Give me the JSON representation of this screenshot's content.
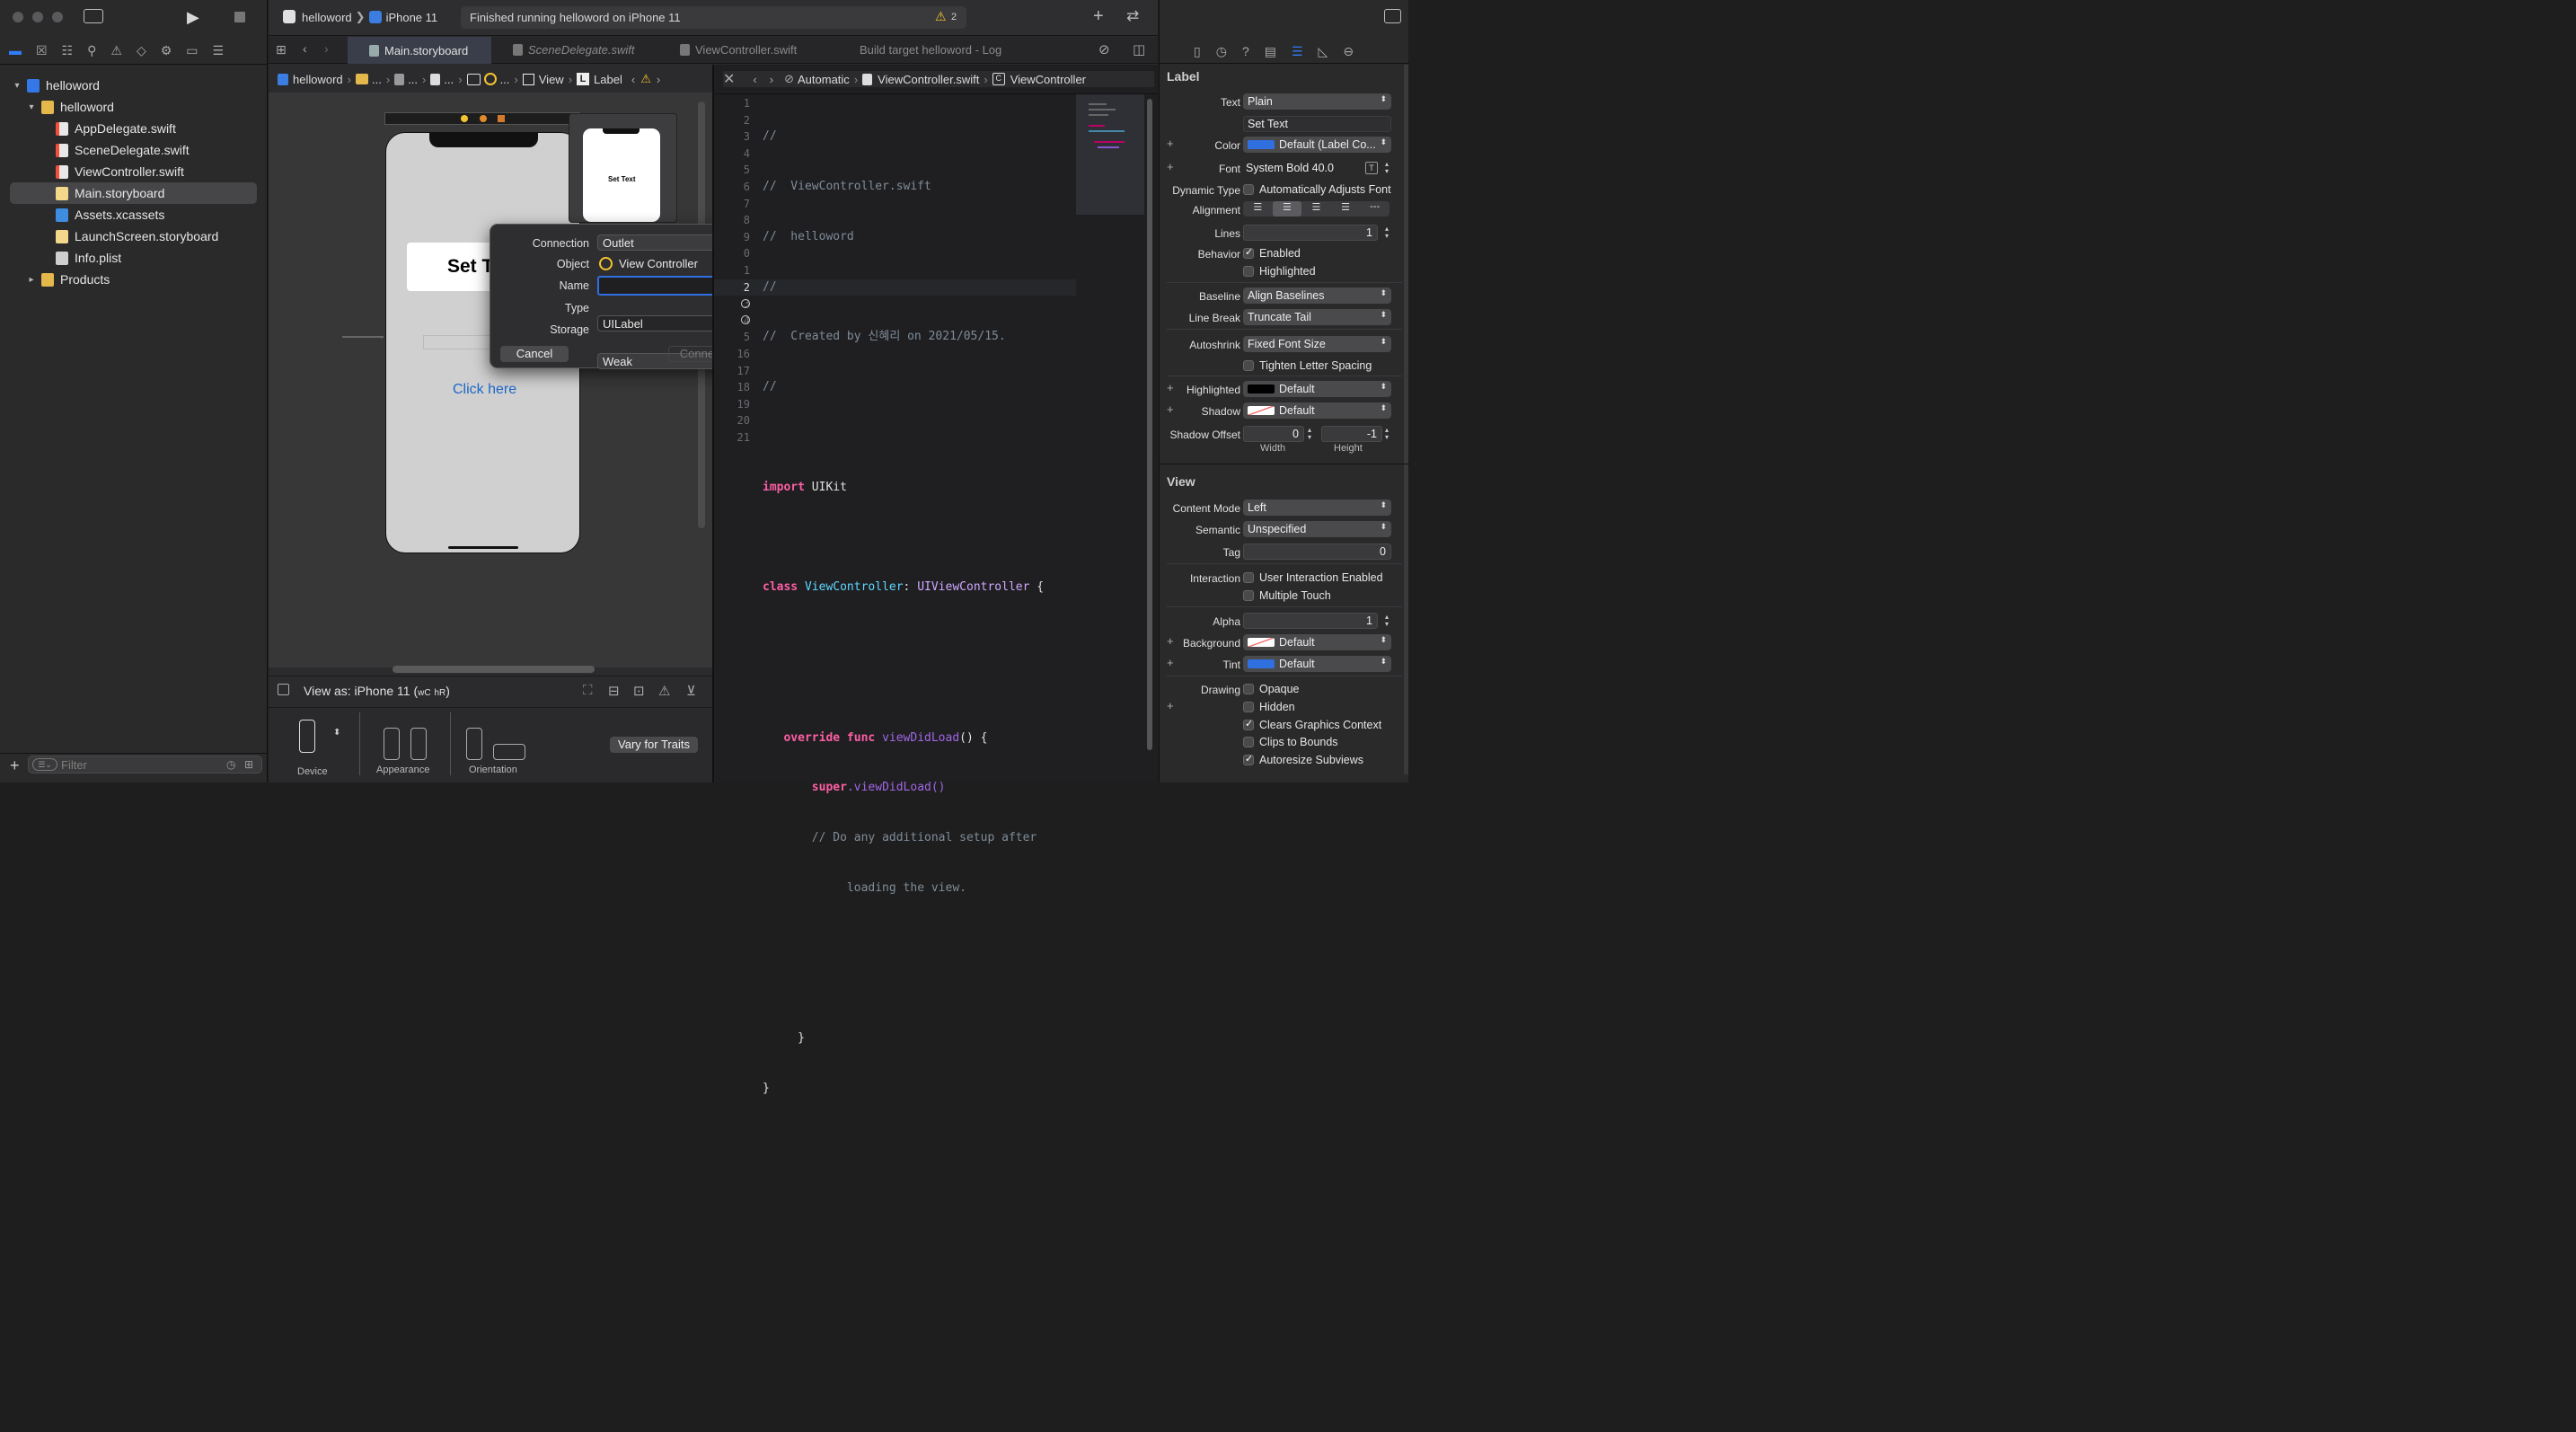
{
  "toolbar": {
    "scheme": "helloword",
    "device": "iPhone 11",
    "activity": "Finished running helloword on iPhone 11",
    "warning_count": "2"
  },
  "tabs": [
    {
      "label": "Main.storyboard"
    },
    {
      "label": "SceneDelegate.swift"
    },
    {
      "label": "ViewController.swift"
    },
    {
      "label": "Build target helloword - Log"
    }
  ],
  "navigator": {
    "project": "helloword",
    "group": "helloword",
    "files": [
      "AppDelegate.swift",
      "SceneDelegate.swift",
      "ViewController.swift",
      "Main.storyboard",
      "Assets.xcassets",
      "LaunchScreen.storyboard",
      "Info.plist"
    ],
    "products": "Products",
    "filter_placeholder": "Filter"
  },
  "ib_jumpbar": {
    "c1": "helloword",
    "c2": "...",
    "c3": "...",
    "c4": "...",
    "c5": "...",
    "c6": "View",
    "c7": "Label"
  },
  "canvas": {
    "big_label": "Set Text",
    "mini_label": "Set Text",
    "button": "Click here",
    "view_as": "View as: iPhone 11 (",
    "view_as_w": "wC",
    "view_as_h": "hR",
    "view_as_end": ")",
    "device_label": "Device",
    "appearance_label": "Appearance",
    "orientation_label": "Orientation",
    "vary": "Vary for Traits"
  },
  "dialog": {
    "connection_label": "Connection",
    "connection": "Outlet",
    "object_label": "Object",
    "object": "View Controller",
    "name_label": "Name",
    "name_value": "",
    "type_label": "Type",
    "type": "UILabel",
    "storage_label": "Storage",
    "storage": "Weak",
    "cancel": "Cancel",
    "connect": "Connect"
  },
  "editor_jumpbar": {
    "mode": "Automatic",
    "file": "ViewController.swift",
    "symbol": "ViewController"
  },
  "code": {
    "line_numbers": [
      "1",
      "2",
      "3",
      "4",
      "5",
      "6",
      "7",
      "8",
      "9",
      "0",
      "1",
      "2",
      "3",
      "4",
      "5",
      "16",
      "17",
      "18",
      "19",
      "20",
      "21"
    ],
    "l1": "//",
    "l2": "//  ViewController.swift",
    "l3": "//  helloword",
    "l4": "//",
    "l5": "//  Created by 신혜리 on 2021/05/15.",
    "l6": "//",
    "import_kw": "import",
    "import_mod": "UIKit",
    "class_kw": "class",
    "class_name": "ViewController",
    "colon": ":",
    "super_type": "UIViewController",
    "brace": "{",
    "override_kw": "override func",
    "func_name": "viewDidLoad",
    "func_tail": "() {",
    "super_kw": "super",
    "super_call": ".viewDidLoad()",
    "comment1": "// Do any additional setup after",
    "comment2": "loading the view.",
    "close1": "}",
    "close2": "}"
  },
  "inspector": {
    "label_section": "Label",
    "text_label": "Text",
    "text_kind": "Plain",
    "text_value": "Set Text",
    "color_label": "Color",
    "color_value": "Default (Label Co...",
    "font_label": "Font",
    "font_value": "System Bold 40.0",
    "dynamic_label": "Dynamic Type",
    "dynamic_value": "Automatically Adjusts Font",
    "alignment_label": "Alignment",
    "lines_label": "Lines",
    "lines_value": "1",
    "behavior_label": "Behavior",
    "enabled": "Enabled",
    "highlighted": "Highlighted",
    "baseline_label": "Baseline",
    "baseline_value": "Align Baselines",
    "linebreak_label": "Line Break",
    "linebreak_value": "Truncate Tail",
    "autoshrink_label": "Autoshrink",
    "autoshrink_value": "Fixed Font Size",
    "tighten": "Tighten Letter Spacing",
    "hl_label": "Highlighted",
    "hl_value": "Default",
    "shadow_label": "Shadow",
    "shadow_value": "Default",
    "shadow_offset_label": "Shadow Offset",
    "offset_w": "0",
    "offset_h": "-1",
    "width_label": "Width",
    "height_label": "Height",
    "view_section": "View",
    "content_mode_label": "Content Mode",
    "content_mode_value": "Left",
    "semantic_label": "Semantic",
    "semantic_value": "Unspecified",
    "tag_label": "Tag",
    "tag_value": "0",
    "interaction_label": "Interaction",
    "user_interaction": "User Interaction Enabled",
    "multi_touch": "Multiple Touch",
    "alpha_label": "Alpha",
    "alpha_value": "1",
    "background_label": "Background",
    "background_value": "Default",
    "tint_label": "Tint",
    "tint_value": "Default",
    "drawing_label": "Drawing",
    "opaque": "Opaque",
    "hidden": "Hidden",
    "clears": "Clears Graphics Context",
    "clips": "Clips to Bounds",
    "autoresize": "Autoresize Subviews"
  },
  "colors": {
    "accent": "#2f6fe0",
    "keyword": "#fc5fa3",
    "type": "#5dd8ff",
    "comment": "#7f8c98",
    "func": "#a167e6"
  }
}
